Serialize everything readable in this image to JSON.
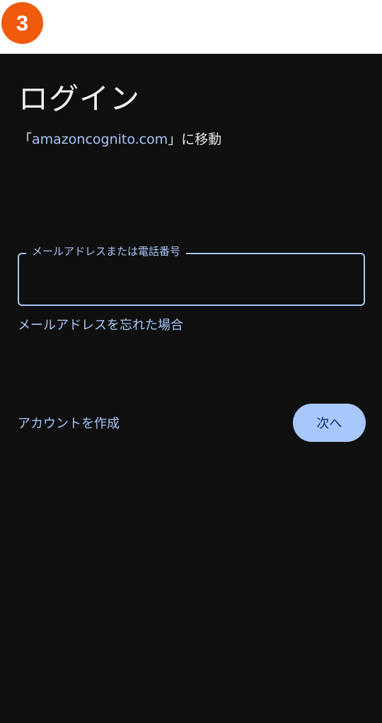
{
  "step_badge": {
    "number": "3",
    "color": "#f05a0c"
  },
  "header": {
    "title": "ログイン"
  },
  "redirect": {
    "open_bracket": "「",
    "domain": "amazoncognito.com",
    "close_text": "」に移動"
  },
  "email_field": {
    "label": "メールアドレスまたは電話番号",
    "value": ""
  },
  "links": {
    "forgot_email": "メールアドレスを忘れた場合",
    "create_account": "アカウントを作成"
  },
  "buttons": {
    "next": "次へ"
  },
  "colors": {
    "background": "#0f0f0f",
    "accent": "#a8c7fa",
    "button_text": "#062e6f",
    "text": "#e6e6e6"
  }
}
